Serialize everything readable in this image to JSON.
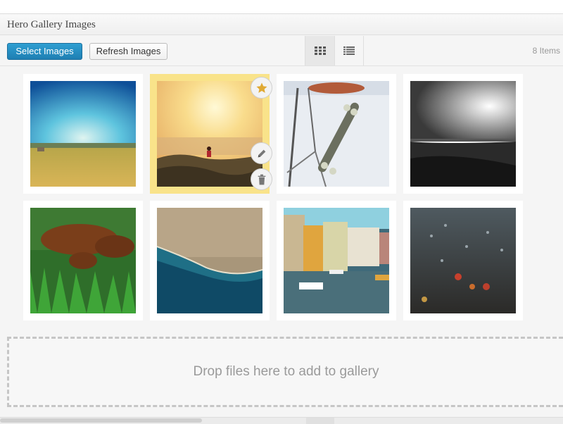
{
  "panel": {
    "title": "Hero Gallery Images"
  },
  "toolbar": {
    "select_label": "Select Images",
    "refresh_label": "Refresh Images",
    "views": [
      {
        "name": "grid-view",
        "icon": "grid-icon",
        "active": true
      },
      {
        "name": "list-view",
        "icon": "list-icon",
        "active": false
      }
    ],
    "item_count": "8 Items"
  },
  "gallery": {
    "images": [
      {
        "subject": "wheat field under blue sky",
        "selected": false
      },
      {
        "subject": "runner in golden sunlight",
        "selected": true,
        "actions": [
          "star-icon",
          "pencil-icon",
          "trash-icon"
        ]
      },
      {
        "subject": "skateboard on bicycle rack",
        "selected": false
      },
      {
        "subject": "black and white sunset landscape",
        "selected": false
      },
      {
        "subject": "dogs in green grass",
        "selected": false
      },
      {
        "subject": "aerial coastline",
        "selected": false
      },
      {
        "subject": "canal with boats and houses",
        "selected": false
      },
      {
        "subject": "raindrops on window at night",
        "selected": false
      }
    ]
  },
  "dropzone": {
    "label": "Drop files here to add to gallery"
  },
  "colors": {
    "primary_button": "#2386bd",
    "selected_highlight": "#f9e38a",
    "star": "#e0a934"
  }
}
